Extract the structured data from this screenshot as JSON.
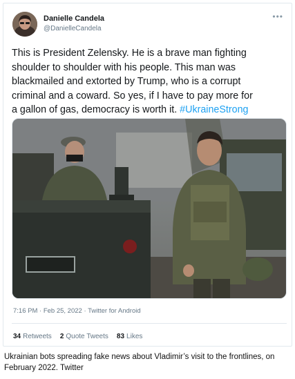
{
  "tweet": {
    "author_name": "Danielle Candela",
    "author_handle": "@DanielleCandela",
    "more_label": "•••",
    "text_lines": [
      "This is President Zelensky. He is a brave man fighting",
      "shoulder to shoulder with his people. This man was",
      "blackmailed and extorted by Trump, who is a corrupt",
      "criminal and a coward. So yes, if I have to pay more for",
      "a gallon of gas, democracy is worth it."
    ],
    "hashtag": "#UkraineStrong",
    "timestamp": "7:16 PM · Feb 25, 2022 · Twitter for Android",
    "stats": {
      "retweets_count": "34",
      "retweets_label": "Retweets",
      "quote_tweets_count": "2",
      "quote_tweets_label": "Quote Tweets",
      "likes_count": "83",
      "likes_label": "Likes"
    }
  },
  "caption": "Ukrainian bots spreading fake news about Vladimir’s visit to the frontlines, on February 2022. Twitter",
  "colors": {
    "link": "#1da1f2",
    "secondary_text": "#657786",
    "border": "#e1e8ed"
  }
}
